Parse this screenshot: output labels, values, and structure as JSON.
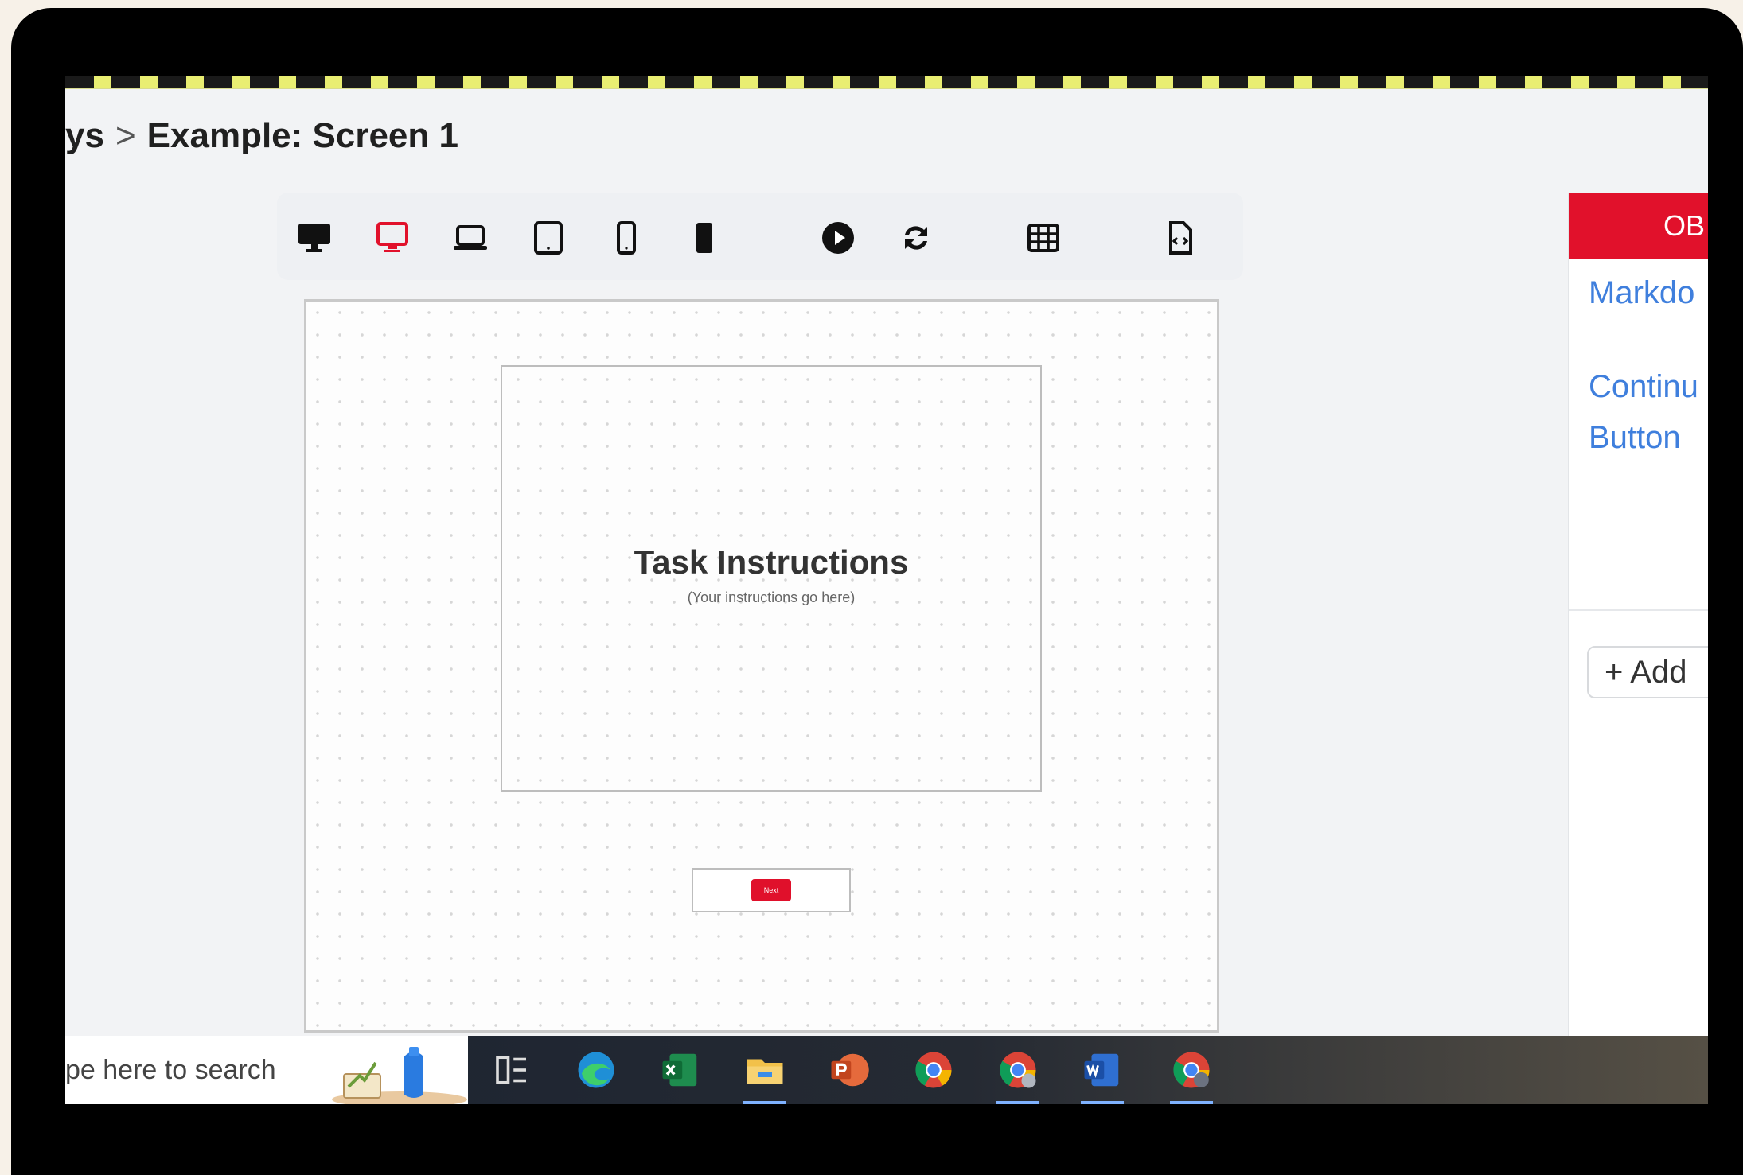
{
  "breadcrumb": {
    "parent": "ys",
    "separator": ">",
    "current": "Example:  Screen 1"
  },
  "toolbar": {
    "icons": [
      "desktop-icon",
      "desktop-small-icon",
      "laptop-icon",
      "tablet-icon",
      "phone-icon",
      "phone-dark-icon",
      "play-icon",
      "refresh-icon",
      "grid-icon",
      "code-file-icon"
    ]
  },
  "canvas": {
    "title": "Task Instructions",
    "subtitle": "(Your instructions go here)",
    "next_button": "Next"
  },
  "right_panel": {
    "header": "OB",
    "links": [
      "Markdo",
      "Continu",
      "Button"
    ],
    "add_button": "+ Add"
  },
  "taskbar": {
    "search_placeholder": "pe here to search",
    "apps": [
      "task-view-icon",
      "edge-icon",
      "excel-icon",
      "file-explorer-icon",
      "powerpoint-icon",
      "chrome-icon",
      "chrome-profile-icon",
      "word-icon",
      "chrome-active-icon"
    ]
  },
  "colors": {
    "accent": "#e1112b",
    "link": "#3f7fdd",
    "bezel": "#000000",
    "background": "#f7f1e8"
  }
}
